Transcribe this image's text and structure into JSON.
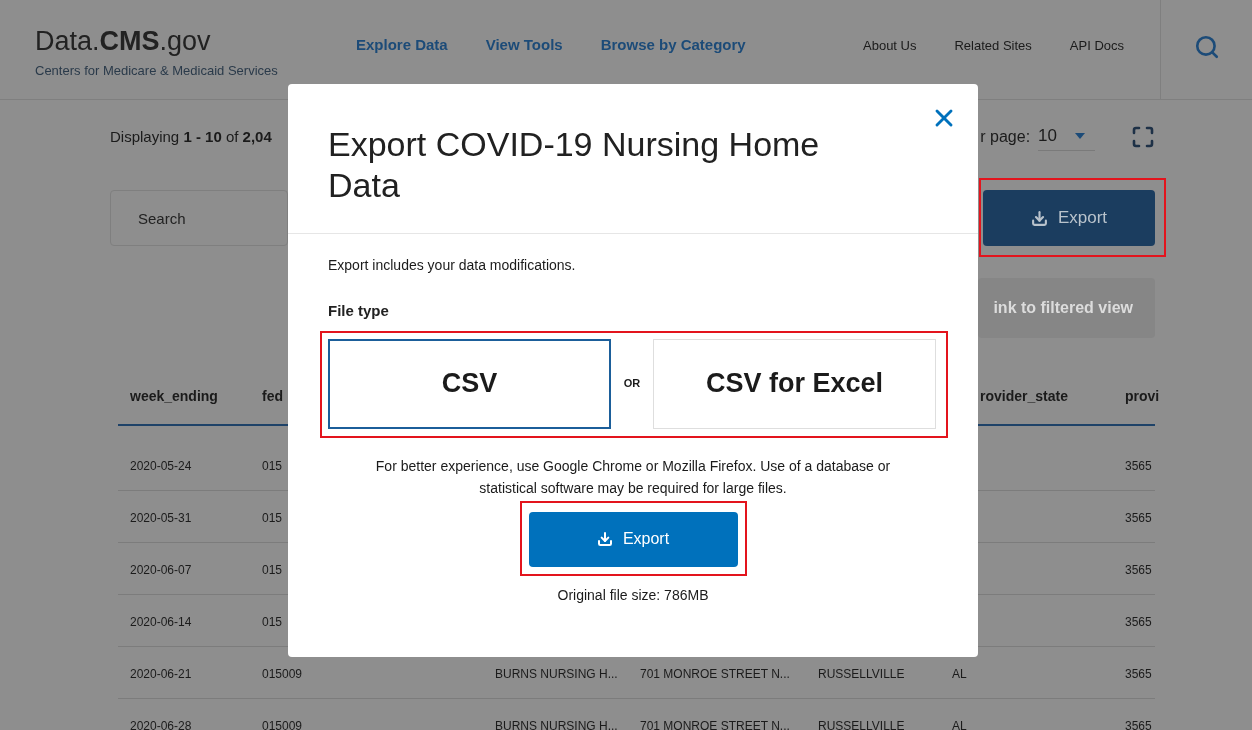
{
  "header": {
    "logo": "Data.**CMS**.gov",
    "subtitle": "Centers for Medicare & Medicaid Services",
    "primary_nav": [
      "Explore Data",
      "View Tools",
      "Browse by Category"
    ],
    "secondary_nav": [
      "About Us",
      "Related Sites",
      "API Docs"
    ]
  },
  "toolbar": {
    "displaying": "Displaying **1 - 10** of **2,04**",
    "rows_per_page_label": "r page:",
    "rows_per_page": "10",
    "search": {
      "placeholder": "Search"
    },
    "export_button": "Export",
    "link_button": {
      "label": "ink to filtered view",
      "disabled": true
    }
  },
  "table": {
    "columns": {
      "column_1": "week_ending",
      "column_2": "fed",
      "column_6": "rovider_state",
      "column_7": "provi"
    },
    "rows": [
      {
        "column_1": "2020-05-24",
        "column_2": "015",
        "column_7": "3565"
      },
      {
        "column_1": "2020-05-31",
        "column_2": "015",
        "column_7": "3565"
      },
      {
        "column_1": "2020-06-07",
        "column_2": "015",
        "column_7": "3565"
      },
      {
        "column_1": "2020-06-14",
        "column_2": "015",
        "column_7": "3565"
      },
      {
        "column_1": "2020-06-21",
        "column_2": "015009",
        "column_3": "BURNS NURSING H...",
        "column_4": "701 MONROE STREET N...",
        "column_5": "RUSSELLVILLE",
        "column_6": "AL",
        "column_7": "3565"
      },
      {
        "column_1": "2020-06-28",
        "column_2": "015009",
        "column_3": "BURNS NURSING H...",
        "column_4": "701 MONROE STREET N...",
        "column_5": "RUSSELLVILLE",
        "column_6": "AL",
        "column_7": "3565"
      }
    ]
  },
  "modal": {
    "title": "Export COVID-19 Nursing Home Data",
    "note": "Export includes your data modifications.",
    "file_type_label": "File type",
    "file_types": [
      {
        "label": "CSV",
        "selected": true
      },
      {
        "label": "CSV for Excel",
        "selected": false
      }
    ],
    "separator": "OR",
    "advice": "For better experience, use Google Chrome or Mozilla Firefox. Use of a database or statistical software may be required for large files.",
    "export_button": "Export",
    "file_size": "Original file size: 786MB"
  }
}
